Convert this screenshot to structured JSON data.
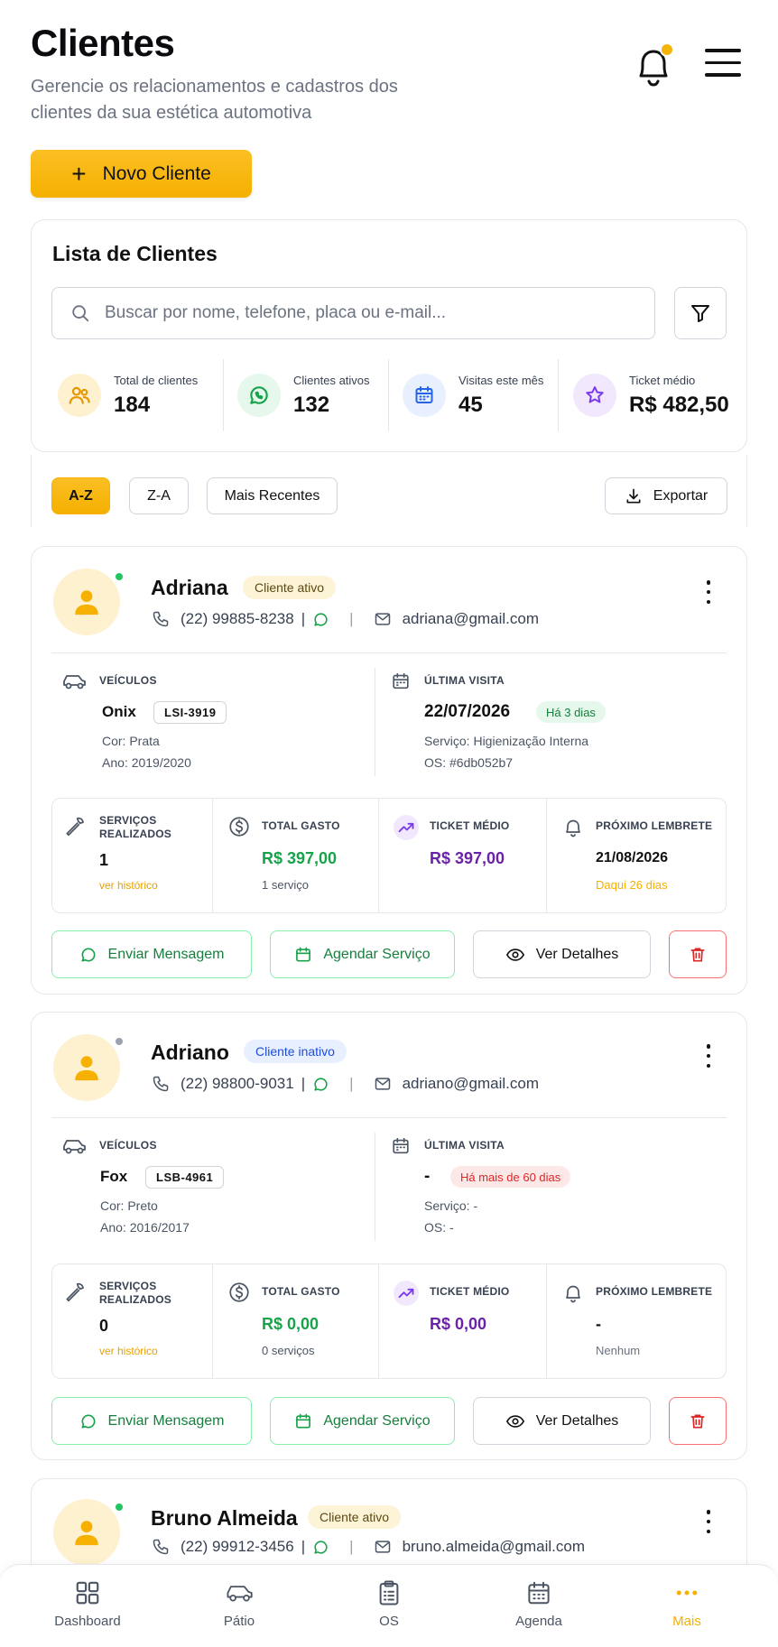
{
  "header": {
    "title": "Clientes",
    "subtitle": "Gerencie os relacionamentos e cadastros dos clientes da sua estética automotiva",
    "new_client_label": "Novo Cliente"
  },
  "list": {
    "title": "Lista de Clientes",
    "search_placeholder": "Buscar por nome, telefone, placa ou e-mail..."
  },
  "stats": [
    {
      "label": "Total de clientes",
      "value": "184",
      "icon": "users-icon",
      "color": "#f59e0b"
    },
    {
      "label": "Clientes ativos",
      "value": "132",
      "icon": "whatsapp-icon",
      "color": "#16a34a"
    },
    {
      "label": "Visitas este mês",
      "value": "45",
      "icon": "calendar-icon",
      "color": "#2563eb"
    },
    {
      "label": "Ticket médio",
      "value": "R$ 482,50",
      "icon": "star-icon",
      "color": "#7c3aed"
    }
  ],
  "sort": {
    "options": [
      "A-Z",
      "Z-A",
      "Mais Recentes"
    ],
    "selected": "A-Z",
    "export_label": "Exportar"
  },
  "labels": {
    "vehicles": "VEÍCULOS",
    "last_visit": "ÚLTIMA VISITA",
    "services_done_1": "SERVIÇOS",
    "services_done_2": "REALIZADOS",
    "total_spent": "TOTAL GASTO",
    "avg_ticket": "TICKET MÉDIO",
    "next_reminder": "PRÓXIMO LEMBRETE",
    "history_link": "ver histórico",
    "send_message": "Enviar Mensagem",
    "schedule": "Agendar Serviço",
    "details": "Ver Detalhes"
  },
  "clients": [
    {
      "name": "Adriana",
      "status": "Cliente ativo",
      "online": true,
      "phone": "(22) 99885-8238",
      "email": "adriana@gmail.com",
      "vehicle": {
        "model": "Onix",
        "plate": "LSI-3919",
        "color": "Cor: Prata",
        "year": "Ano: 2019/2020"
      },
      "last_visit": {
        "date": "22/07/2026",
        "tag": "Há 3 dias",
        "service": "Serviço: Higienização Interna",
        "os": "OS: #6db052b7"
      },
      "services": "1",
      "total_spent": "R$ 397,00",
      "total_spent_sub": "1 serviço",
      "avg_ticket": "R$ 397,00",
      "reminder": "21/08/2026",
      "reminder_sub": "Daqui 26 dias"
    },
    {
      "name": "Adriano",
      "status": "Cliente inativo",
      "online": false,
      "phone": "(22) 98800-9031",
      "email": "adriano@gmail.com",
      "vehicle": {
        "model": "Fox",
        "plate": "LSB-4961",
        "color": "Cor: Preto",
        "year": "Ano: 2016/2017"
      },
      "last_visit": {
        "date": "-",
        "tag": "Há mais de 60 dias",
        "service": "Serviço: -",
        "os": "OS: -"
      },
      "services": "0",
      "total_spent": "R$ 0,00",
      "total_spent_sub": "0 serviços",
      "avg_ticket": "R$ 0,00",
      "reminder": "-",
      "reminder_sub": "Nenhum"
    },
    {
      "name": "Bruno Almeida",
      "status": "Cliente ativo",
      "online": true,
      "phone": "(22) 99912-3456",
      "email": "bruno.almeida@gmail.com"
    }
  ],
  "nav": [
    {
      "label": "Dashboard",
      "icon": "dashboard-icon"
    },
    {
      "label": "Pátio",
      "icon": "car-icon"
    },
    {
      "label": "OS",
      "icon": "clipboard-icon"
    },
    {
      "label": "Agenda",
      "icon": "calendar-icon"
    },
    {
      "label": "Mais",
      "icon": "more-icon",
      "active": true
    }
  ],
  "colors": {
    "accent": "#f5b000",
    "green": "#16a34a",
    "purple": "#6b21a8",
    "red": "#dc2626"
  }
}
